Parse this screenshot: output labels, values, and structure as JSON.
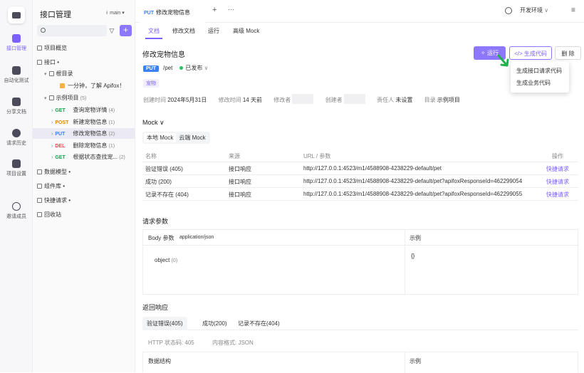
{
  "nav": {
    "items": [
      {
        "label": "接口管理",
        "icon": "api-management-icon"
      },
      {
        "label": "自动化测试",
        "icon": "automation-test-icon"
      },
      {
        "label": "分享文档",
        "icon": "share-doc-icon"
      },
      {
        "label": "请求历史",
        "icon": "history-icon"
      },
      {
        "label": "项目设置",
        "icon": "settings-icon"
      },
      {
        "label": "邀请成员",
        "icon": "invite-member-icon"
      }
    ]
  },
  "sidebar": {
    "title": "接口管理",
    "branch": "main",
    "tree": [
      {
        "label": "项目概览",
        "depth": 0,
        "icon": "overview-icon"
      },
      {
        "label": "接口 •",
        "depth": 0,
        "arrow": "▾"
      },
      {
        "label": "根目录",
        "depth": 1,
        "arrow": "▾"
      },
      {
        "label": "一分钟，了解 Apifox！",
        "depth": 2,
        "emoji": true
      },
      {
        "label": "示例项目",
        "count": "(5)",
        "depth": 1,
        "arrow": "▾"
      },
      {
        "label": "查询宠物详情",
        "method": "GET",
        "count": "(4)",
        "depth": 2,
        "arrow": "›"
      },
      {
        "label": "新建宠物信息",
        "method": "POST",
        "count": "(1)",
        "depth": 2,
        "arrow": "›"
      },
      {
        "label": "修改宠物信息",
        "method": "PUT",
        "count": "(2)",
        "depth": 2,
        "arrow": "›",
        "selected": true
      },
      {
        "label": "删除宠物信息",
        "method": "DEL",
        "count": "(1)",
        "depth": 2,
        "arrow": "›"
      },
      {
        "label": "根据状态查找宠...",
        "method": "GET",
        "count": "(2)",
        "depth": 2,
        "arrow": "›"
      },
      {
        "label": "数据模型 •",
        "depth": 0
      },
      {
        "label": "组件库 •",
        "depth": 0
      },
      {
        "label": "快捷请求 •",
        "depth": 0
      },
      {
        "label": "回收站",
        "depth": 0
      }
    ]
  },
  "topbar": {
    "tab_method": "PUT",
    "tab_title": "修改宠物信息",
    "add": "+",
    "more": "···",
    "env": "开发环境"
  },
  "subtabs": [
    "文档",
    "修改文档",
    "运行",
    "高级 Mock"
  ],
  "api": {
    "title": "修改宠物信息",
    "method": "PUT",
    "path": "/pet",
    "status": "已发布",
    "tag": "宠物",
    "run_label": "运行",
    "gen_label": "生成代码",
    "delete_label": "删 除",
    "meta": {
      "created_label": "创建时间",
      "created": "2024年5月31日",
      "modified_label": "修改时间",
      "modified": "14 天前",
      "modifier_label": "修改者",
      "creator_label": "创建者",
      "owner_label": "责任人",
      "owner": "未设置",
      "dir_label": "目录",
      "dir": "示例项目"
    }
  },
  "gen_menu": [
    "生成接口请求代码",
    "生成业务代码"
  ],
  "mock": {
    "title": "Mock",
    "tabs": [
      "本地 Mock",
      "云端 Mock"
    ],
    "columns": [
      "名称",
      "来源",
      "URL / 参数",
      "操作"
    ],
    "rows": [
      {
        "name": "验证错误 (405)",
        "source": "接口响应",
        "url": "http://127.0.0.1:4523/m1/4588908-4238229-default/pet",
        "op": "快捷请求"
      },
      {
        "name": "成功 (200)",
        "source": "接口响应",
        "url": "http://127.0.0.1:4523/m1/4588908-4238229-default/pet?apifoxResponseId=462299054",
        "op": "快捷请求"
      },
      {
        "name": "记录不存在 (404)",
        "source": "接口响应",
        "url": "http://127.0.0.1:4523/m1/4588908-4238229-default/pet?apifoxResponseId=462299055",
        "op": "快捷请求"
      }
    ]
  },
  "request": {
    "title": "请求参数",
    "body_label": "Body 参数",
    "content_type": "application/json",
    "example_label": "示例",
    "field": "object",
    "field_count": "(0)",
    "example": "{}"
  },
  "response": {
    "title": "返回响应",
    "tabs": [
      "验证错误(405)",
      "成功(200)",
      "记录不存在(404)"
    ],
    "http_code_label": "HTTP 状态码: 405",
    "format_label": "内容格式: JSON",
    "structure_label": "数据结构",
    "example_label": "示例"
  }
}
